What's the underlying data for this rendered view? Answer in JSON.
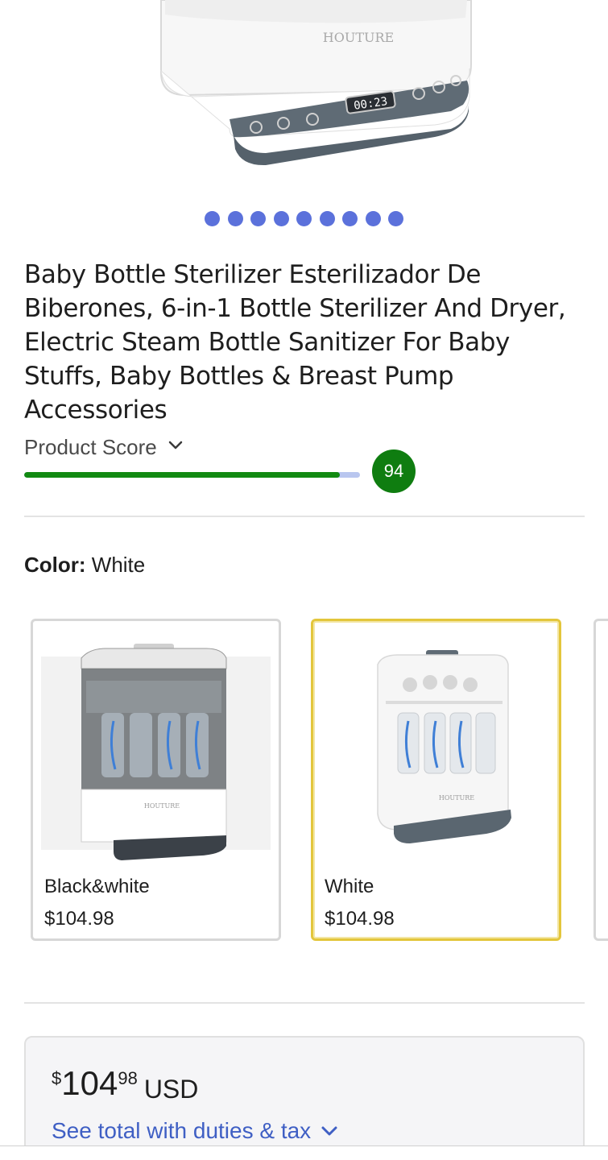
{
  "hero": {
    "brand_text": "HOUTURE",
    "timer_display": "00:23",
    "carousel_count": 9
  },
  "product": {
    "title": "Baby Bottle Sterilizer Esterilizador De Biberones, 6-in-1 Bottle Sterilizer And Dryer, Electric Steam Bottle Sanitizer For Baby Stuffs, Baby Bottles & Breast Pump Accessories"
  },
  "score": {
    "label": "Product Score",
    "value": "94",
    "fill_fraction": 0.94
  },
  "color": {
    "label": "Color:",
    "selected": "White"
  },
  "swatches": [
    {
      "name": "Black&white",
      "price": "$104.98",
      "brand": "HOUTURE"
    },
    {
      "name": "White",
      "price": "$104.98",
      "brand": "HOUTURE"
    }
  ],
  "price": {
    "symbol": "$",
    "whole": "104",
    "cents": "98",
    "currency": "USD",
    "duties_link": "See total with duties & tax"
  },
  "colors": {
    "accent_blue": "#3f5fc4",
    "dot_blue": "#5b71db",
    "score_green": "#0f7d10",
    "selected_border": "#e3c63c"
  }
}
